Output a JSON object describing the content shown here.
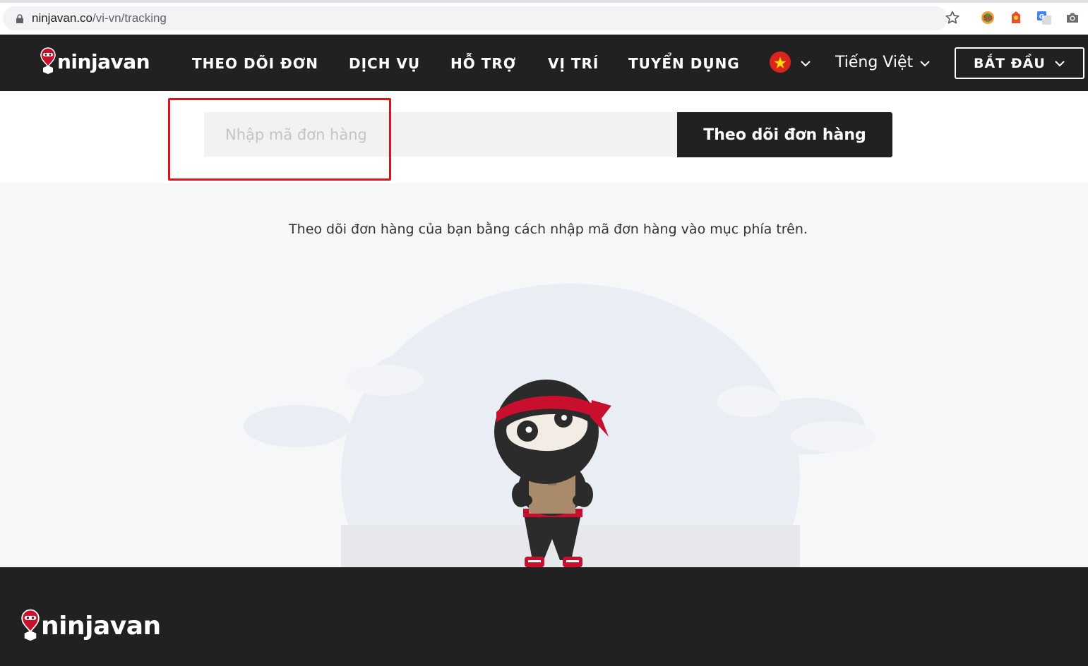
{
  "browser": {
    "url_host": "ninjavan.co",
    "url_path": "/vi-vn/tracking"
  },
  "header": {
    "logo": "ninjavan",
    "nav": [
      {
        "label": "THEO DÕI ĐƠN"
      },
      {
        "label": "DỊCH VỤ"
      },
      {
        "label": "HỖ TRỢ"
      },
      {
        "label": "VỊ TRÍ"
      },
      {
        "label": "TUYỂN DỤNG"
      }
    ],
    "language": "Tiếng Việt",
    "start_button": "BẮT ĐẦU"
  },
  "search": {
    "placeholder": "Nhập mã đơn hàng",
    "value": "",
    "button": "Theo dõi đơn hàng"
  },
  "main": {
    "hint": "Theo dõi đơn hàng của bạn bằng cách nhập mã đơn hàng vào mục phía trên."
  },
  "footer": {
    "logo": "ninjavan"
  },
  "colors": {
    "header_bg": "#212121",
    "brand_red": "#c8102e",
    "highlight": "#e0101a",
    "main_bg": "#f6f7f9"
  },
  "icons": [
    "lock-icon",
    "bookmark-star-icon",
    "extension-icon",
    "translate-icon",
    "camera-icon",
    "vietnam-flag-icon",
    "chevron-down-icon",
    "ninja-mascot-illustration"
  ]
}
